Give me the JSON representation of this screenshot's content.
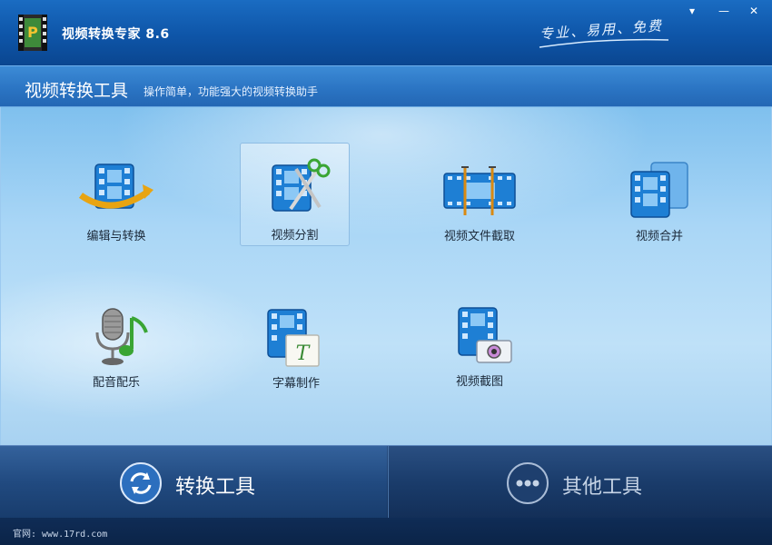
{
  "window": {
    "title": "视频转换专家 8.6",
    "slogan": "专业、易用、免费",
    "buttons": {
      "menu": "▾",
      "minimize": "—",
      "close": "✕"
    }
  },
  "header": {
    "title": "视频转换工具",
    "description": "操作简单，功能强大的视频转换助手"
  },
  "tools": [
    {
      "label": "编辑与转换",
      "icon": "film-convert-icon",
      "selected": false
    },
    {
      "label": "视频分割",
      "icon": "film-scissors-icon",
      "selected": true
    },
    {
      "label": "视频文件截取",
      "icon": "film-trim-icon",
      "selected": false
    },
    {
      "label": "视频合并",
      "icon": "film-merge-icon",
      "selected": false
    },
    {
      "label": "配音配乐",
      "icon": "microphone-music-icon",
      "selected": false
    },
    {
      "label": "字幕制作",
      "icon": "film-subtitle-icon",
      "selected": false
    },
    {
      "label": "视频截图",
      "icon": "film-camera-icon",
      "selected": false
    }
  ],
  "tabs": [
    {
      "label": "转换工具",
      "icon": "refresh-icon",
      "active": true
    },
    {
      "label": "其他工具",
      "icon": "more-dots-icon",
      "active": false
    }
  ],
  "status": {
    "text": "官网: www.17rd.com"
  },
  "colors": {
    "accent": "#1a6cc2",
    "film_blue": "#1e7fd4",
    "active_tab": "#2a5a96"
  }
}
